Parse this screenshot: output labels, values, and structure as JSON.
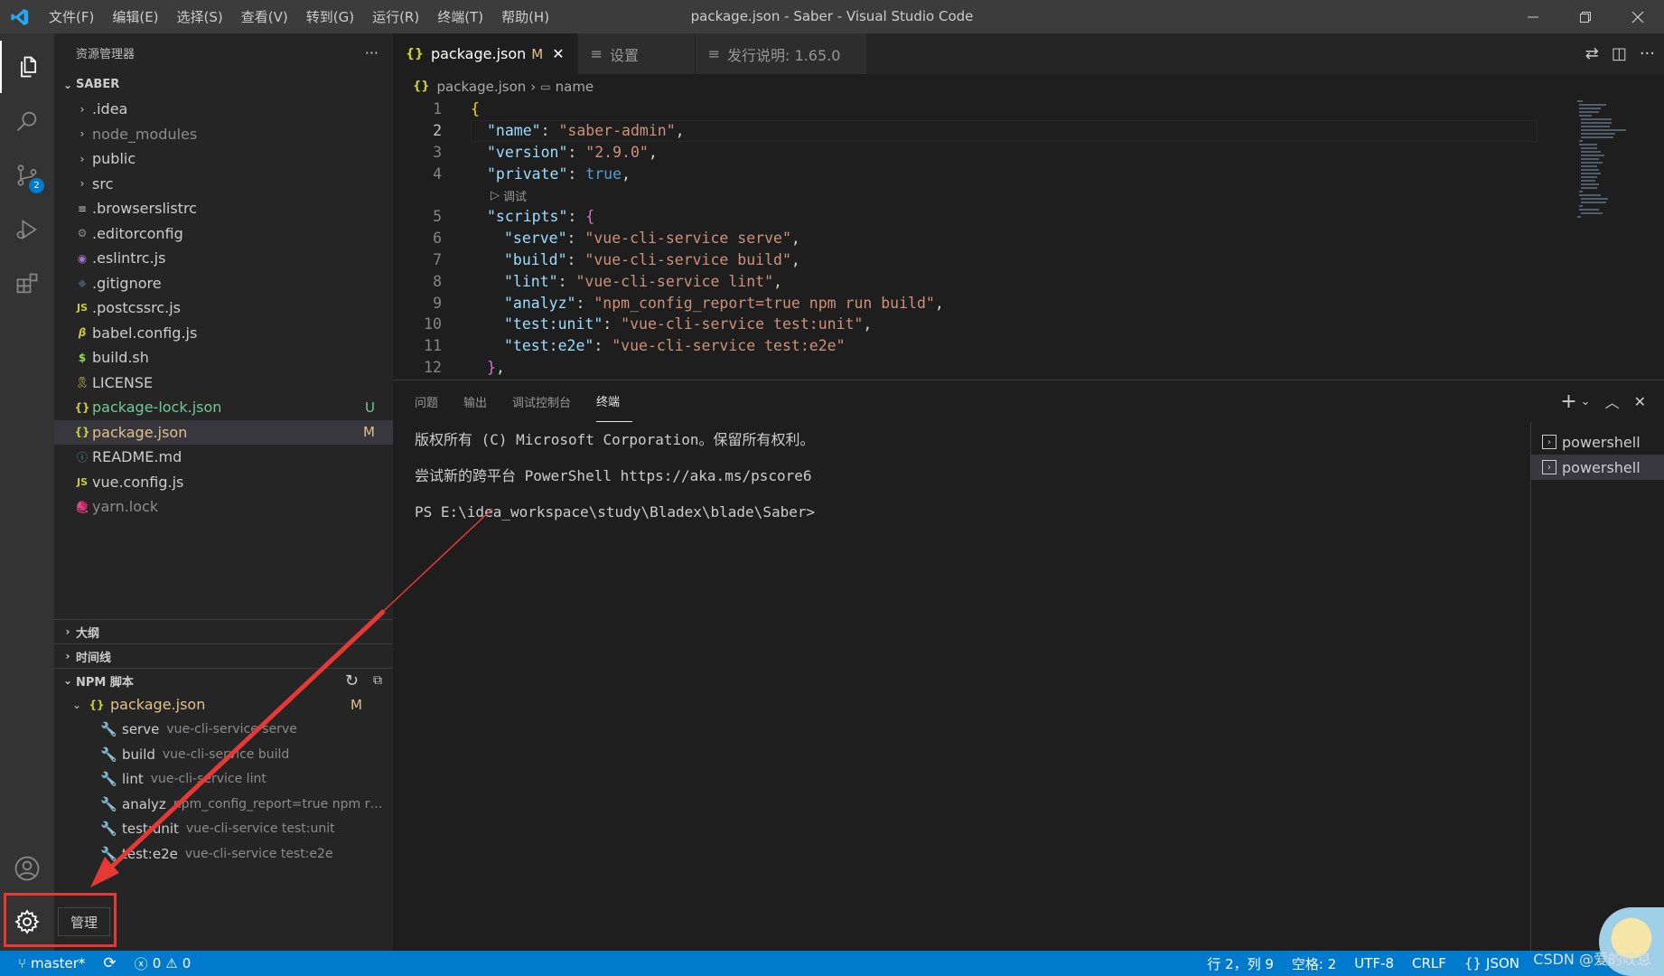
{
  "titlebar": {
    "menus": [
      "文件(F)",
      "编辑(E)",
      "选择(S)",
      "查看(V)",
      "转到(G)",
      "运行(R)",
      "终端(T)",
      "帮助(H)"
    ],
    "window_title": "package.json - Saber - Visual Studio Code"
  },
  "activity": {
    "scm_badge": "2",
    "manage_tooltip": "管理"
  },
  "explorer": {
    "header": "资源管理器",
    "more": "···",
    "root": "SABER",
    "items": [
      {
        "label": ".idea",
        "type": "folder",
        "color": "#cccccc"
      },
      {
        "label": "node_modules",
        "type": "folder",
        "color": "#8c8c8c"
      },
      {
        "label": "public",
        "type": "folder",
        "color": "#cccccc"
      },
      {
        "label": "src",
        "type": "folder",
        "color": "#cccccc"
      },
      {
        "label": ".browserslistrc",
        "type": "file",
        "color": "#cccccc"
      },
      {
        "label": ".editorconfig",
        "type": "file",
        "color": "#cccccc"
      },
      {
        "label": ".eslintrc.js",
        "type": "file",
        "color": "#cccccc"
      },
      {
        "label": ".gitignore",
        "type": "file",
        "color": "#cccccc"
      },
      {
        "label": ".postcssrc.js",
        "type": "file",
        "color": "#cccccc"
      },
      {
        "label": "babel.config.js",
        "type": "file",
        "color": "#cccccc"
      },
      {
        "label": "build.sh",
        "type": "file",
        "color": "#cccccc"
      },
      {
        "label": "LICENSE",
        "type": "file",
        "color": "#cccccc"
      },
      {
        "label": "package-lock.json",
        "type": "file",
        "color": "#73c991",
        "decoration": "U"
      },
      {
        "label": "package.json",
        "type": "file",
        "color": "#e2c08d",
        "decoration": "M"
      },
      {
        "label": "README.md",
        "type": "file",
        "color": "#cccccc"
      },
      {
        "label": "vue.config.js",
        "type": "file",
        "color": "#cccccc"
      },
      {
        "label": "yarn.lock",
        "type": "file",
        "color": "#8c8c8c"
      }
    ],
    "outline": "大纲",
    "timeline": "时间线",
    "npm_header": "NPM 脚本",
    "npm_file": "package.json",
    "npm_file_decoration": "M",
    "scripts": [
      {
        "name": "serve",
        "cmd": "vue-cli-service serve"
      },
      {
        "name": "build",
        "cmd": "vue-cli-service build"
      },
      {
        "name": "lint",
        "cmd": "vue-cli-service lint"
      },
      {
        "name": "analyz",
        "cmd": "npm_config_report=true npm run..."
      },
      {
        "name": "test:unit",
        "cmd": "vue-cli-service test:unit"
      },
      {
        "name": "test:e2e",
        "cmd": "vue-cli-service test:e2e"
      }
    ]
  },
  "editor": {
    "tabs": [
      {
        "label": "package.json",
        "modified": "M",
        "close": "✕",
        "active": true
      },
      {
        "label": "设置",
        "active": false
      },
      {
        "label": "发行说明: 1.65.0",
        "active": false
      }
    ],
    "breadcrumb": {
      "file": "package.json",
      "symbol": "name"
    },
    "codelens": "调试",
    "line_numbers": [
      "1",
      "2",
      "3",
      "4",
      "5",
      "6",
      "7",
      "8",
      "9",
      "10",
      "11",
      "12"
    ],
    "code": {
      "l1": "{",
      "l2k": "\"name\"",
      "l2v": "\"saber-admin\"",
      "l3k": "\"version\"",
      "l3v": "\"2.9.0\"",
      "l4k": "\"private\"",
      "l4v": "true",
      "l5k": "\"scripts\"",
      "l5v": "{",
      "l6k": "\"serve\"",
      "l6v": "\"vue-cli-service serve\"",
      "l7k": "\"build\"",
      "l7v": "\"vue-cli-service build\"",
      "l8k": "\"lint\"",
      "l8v": "\"vue-cli-service lint\"",
      "l9k": "\"analyz\"",
      "l9v": "\"npm_config_report=true npm run build\"",
      "l10k": "\"test:unit\"",
      "l10v": "\"vue-cli-service test:unit\"",
      "l11k": "\"test:e2e\"",
      "l11v": "\"vue-cli-service test:e2e\"",
      "l12": "},"
    }
  },
  "panel": {
    "tabs": [
      "问题",
      "输出",
      "调试控制台",
      "终端"
    ],
    "terminal_lines": [
      "版权所有 (C) Microsoft Corporation。保留所有权利。",
      "尝试新的跨平台 PowerShell https://aka.ms/pscore6",
      "PS E:\\idea_workspace\\study\\Bladex\\blade\\Saber>"
    ],
    "terminals": [
      "powershell",
      "powershell"
    ]
  },
  "statusbar": {
    "branch": "master*",
    "errors": "0",
    "warnings": "0",
    "position": "行 2，列 9",
    "spaces": "空格: 2",
    "encoding": "UTF-8",
    "eol": "CRLF",
    "language": "JSON"
  },
  "watermark": "CSDN @爱的叹息"
}
